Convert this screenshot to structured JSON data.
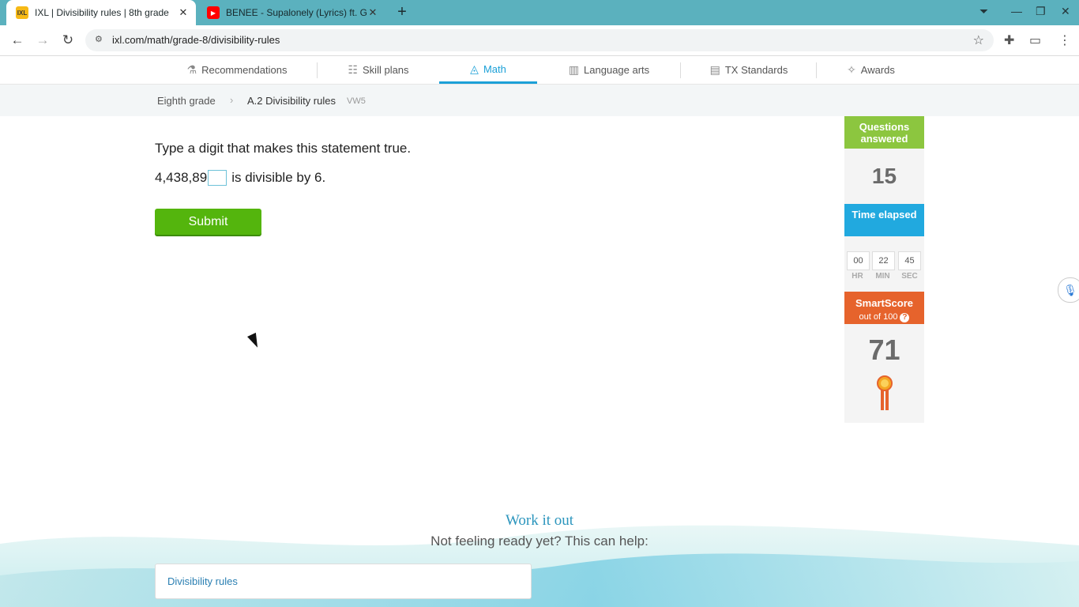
{
  "browser": {
    "tabs": [
      {
        "title": "IXL | Divisibility rules | 8th grade",
        "active": true,
        "favicon": "IXL"
      },
      {
        "title": "BENEE - Supalonely (Lyrics) ft. Gus Dapperton",
        "active": false,
        "favicon": "youtube-icon"
      }
    ],
    "url": "ixl.com/math/grade-8/divisibility-rules"
  },
  "nav": {
    "items": [
      {
        "label": "Recommendations",
        "icon": "recommendations-icon"
      },
      {
        "label": "Skill plans",
        "icon": "skill-plans-icon"
      },
      {
        "label": "Math",
        "icon": "math-icon",
        "active": true
      },
      {
        "label": "Language arts",
        "icon": "book-icon"
      },
      {
        "label": "TX Standards",
        "icon": "standards-icon"
      },
      {
        "label": "Awards",
        "icon": "awards-icon"
      }
    ]
  },
  "breadcrumb": {
    "grade": "Eighth grade",
    "skill": "A.2 Divisibility rules",
    "code": "VW5"
  },
  "question": {
    "prompt": "Type a digit that makes this statement true.",
    "number_prefix": "4,438,89",
    "suffix": "is divisible by 6.",
    "answer_value": "",
    "submit_label": "Submit"
  },
  "stats": {
    "questions_label": "Questions answered",
    "questions_value": "15",
    "time_label": "Time elapsed",
    "hours": "00",
    "minutes": "22",
    "seconds": "45",
    "hr_label": "HR",
    "min_label": "MIN",
    "sec_label": "SEC",
    "smartscore_label": "SmartScore",
    "smartscore_sub": "out of 100",
    "smartscore_help": "?",
    "smartscore_value": "71"
  },
  "help": {
    "heading": "Work it out",
    "subheading": "Not feeling ready yet? This can help:",
    "link": "Divisibility rules"
  },
  "colors": {
    "chrome_tabbar": "#5bb1be",
    "ixl_blue": "#1ba0d7",
    "submit_green": "#54b50d",
    "questions_green": "#8cc63f",
    "time_blue": "#21a9df",
    "smartscore_orange": "#e6632c"
  }
}
